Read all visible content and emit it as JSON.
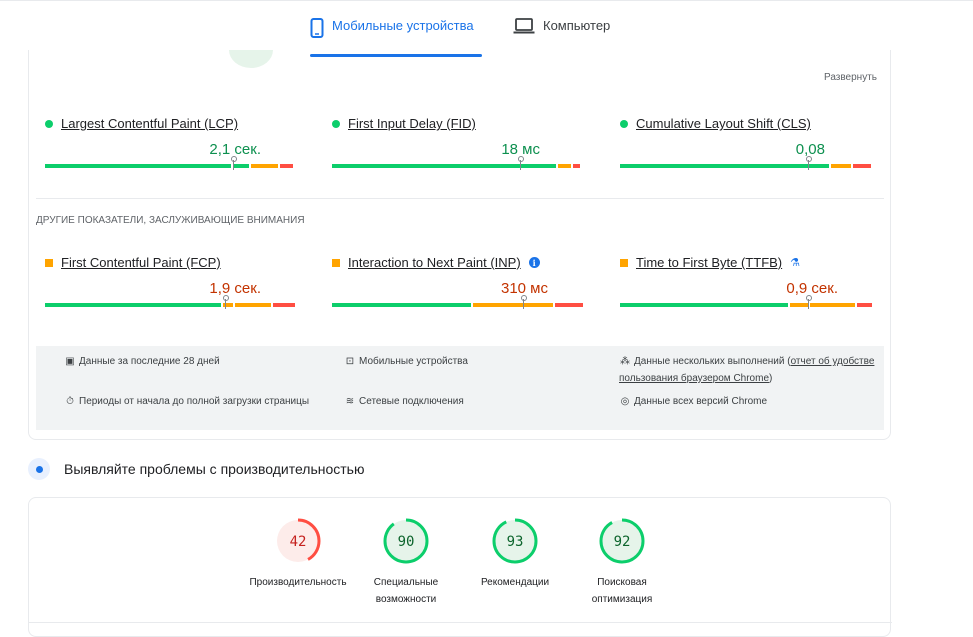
{
  "tabs": {
    "mobile": "Мобильные устройства",
    "desktop": "Компьютер"
  },
  "field_data": {
    "expand": "Развернуть",
    "core_metrics": [
      {
        "name": "Largest Contentful Paint (LCP)",
        "value": "2,1 сек.",
        "status": "good",
        "marker_fraction": 0.75
      },
      {
        "name": "First Input Delay (FID)",
        "value": "18 мс",
        "status": "good",
        "marker_fraction": 0.75
      },
      {
        "name": "Cumulative Layout Shift (CLS)",
        "value": "0,08",
        "status": "good",
        "marker_fraction": 0.75
      }
    ],
    "other_heading": "Другие показатели, заслуживающие внимания",
    "other_metrics": [
      {
        "name": "First Contentful Paint (FCP)",
        "value": "1,9 сек.",
        "status": "average",
        "marker_fraction": 0.72
      },
      {
        "name": "Interaction to Next Paint (INP)",
        "value": "310 мс",
        "status": "average",
        "marker_fraction": 0.76
      },
      {
        "name": "Time to First Byte (TTFB)",
        "value": "0,9 сек.",
        "status": "average",
        "marker_fraction": 0.75
      }
    ],
    "info": {
      "period": "Данные за последние 28 дней",
      "device": "Мобильные устройства",
      "samples_prefix": "Данные нескольких выполнений (",
      "samples_link": "отчет об удобстве пользования браузером Chrome",
      "samples_suffix": ")",
      "durations": "Периоды от начала до полной загрузки страницы",
      "network": "Сетевые подключения",
      "versions": "Данные всех версий Chrome"
    }
  },
  "diagnose": {
    "title": "Выявляйте проблемы с производительностью",
    "scores": [
      {
        "label": "Производительность",
        "value": "42",
        "score": 42,
        "color": "#ff4e42"
      },
      {
        "label": "Специальные возможности",
        "value": "90",
        "score": 90,
        "color": "#0cce6b"
      },
      {
        "label": "Рекомендации",
        "value": "93",
        "score": 93,
        "color": "#0cce6b"
      },
      {
        "label": "Поисковая оптимизация",
        "value": "92",
        "score": 92,
        "color": "#0cce6b"
      }
    ]
  },
  "colors": {
    "good": "#0cce6b",
    "average": "#ffa400",
    "poor": "#ff4e42",
    "accent": "#1a73e8"
  }
}
